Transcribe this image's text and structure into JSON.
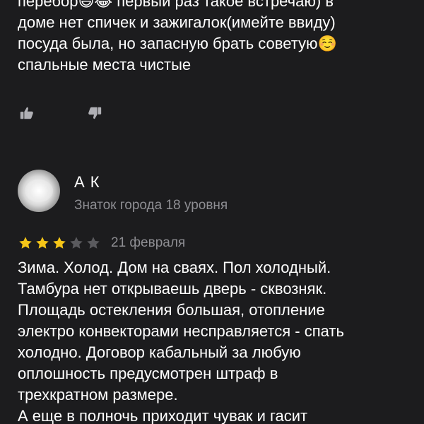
{
  "previous_review": {
    "text": "перебор😃😂 первый раз такое встречаю) в\nдоме нет спичек и зажигалок(имейте ввиду)\nпосуда была, но запасную брать советую☺️\nспальные места чистые"
  },
  "reactions": {
    "like_icon": "thumbs-up-icon",
    "dislike_icon": "thumbs-down-icon"
  },
  "review": {
    "author_name": "А К",
    "author_level": "Знаток города 18 уровня",
    "rating": 3,
    "max_rating": 5,
    "date": "21 февраля",
    "text": "Зима. Холод. Дом на сваях. Пол холодный.\nТамбура нет открываешь дверь - сквозняк.\nПлощадь остекления большая, отопление\nэлектро конвекторами несправляется - спать\nхолодно. Договор кабальный за любую\nоплошность предусмотрен штраф в\nтрехкратном размере.\nА еще в полночь приходит чувак и гасит"
  },
  "colors": {
    "background": "#1c1c1e",
    "text": "#ffffff",
    "secondary_text": "#8e8e93",
    "star_filled": "#f5c518",
    "star_empty": "#5a5a5e"
  }
}
